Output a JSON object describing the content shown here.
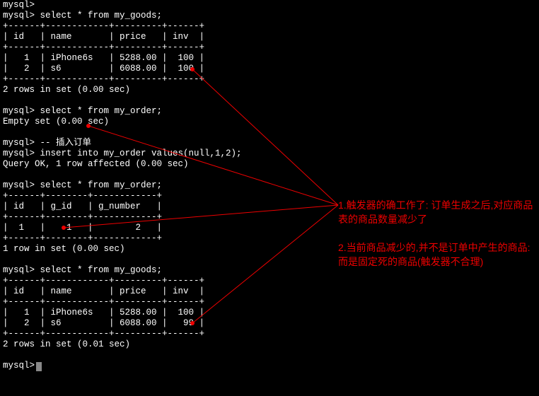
{
  "terminal": {
    "lines": [
      "mysql>",
      "mysql> select * from my_goods;",
      "+------+------------+---------+------+",
      "| id   | name       | price   | inv  |",
      "+------+------------+---------+------+",
      "|   1  | iPhone6s   | 5288.00 |  100 |",
      "|   2  | s6         | 6088.00 |  100 |",
      "+------+------------+---------+------+",
      "2 rows in set (0.00 sec)",
      "",
      "mysql> select * from my_order;",
      "Empty set (0.00 sec)",
      "",
      "mysql> -- 插入订单",
      "mysql> insert into my_order values(null,1,2);",
      "Query OK, 1 row affected (0.00 sec)",
      "",
      "mysql> select * from my_order;",
      "+------+--------+------------+",
      "| id   | g_id   | g_number   |",
      "+------+--------+------------+",
      "|  1   |    1   |        2   |",
      "+------+--------+------------+",
      "1 row in set (0.00 sec)",
      "",
      "mysql> select * from my_goods;",
      "+------+------------+---------+------+",
      "| id   | name       | price   | inv  |",
      "+------+------------+---------+------+",
      "|   1  | iPhone6s   | 5288.00 |  100 |",
      "|   2  | s6         | 6088.00 |   99 |",
      "+------+------------+---------+------+",
      "2 rows in set (0.01 sec)",
      "",
      "mysql>"
    ]
  },
  "annotation": {
    "p1": "1.触发器的确工作了: 订单生成之后,对应商品表的商品数量减少了",
    "p2": "2.当前商品减少的,并不是订单中产生的商品: 而是固定死的商品(触发器不合理)"
  },
  "chart_data": {
    "type": "table",
    "title": "my_goods before/after trigger",
    "before": [
      {
        "id": 1,
        "name": "iPhone6s",
        "price": 5288.0,
        "inv": 100
      },
      {
        "id": 2,
        "name": "s6",
        "price": 6088.0,
        "inv": 100
      }
    ],
    "after": [
      {
        "id": 1,
        "name": "iPhone6s",
        "price": 5288.0,
        "inv": 100
      },
      {
        "id": 2,
        "name": "s6",
        "price": 6088.0,
        "inv": 99
      }
    ],
    "order_inserted": {
      "id": 1,
      "g_id": 1,
      "g_number": 2
    }
  }
}
